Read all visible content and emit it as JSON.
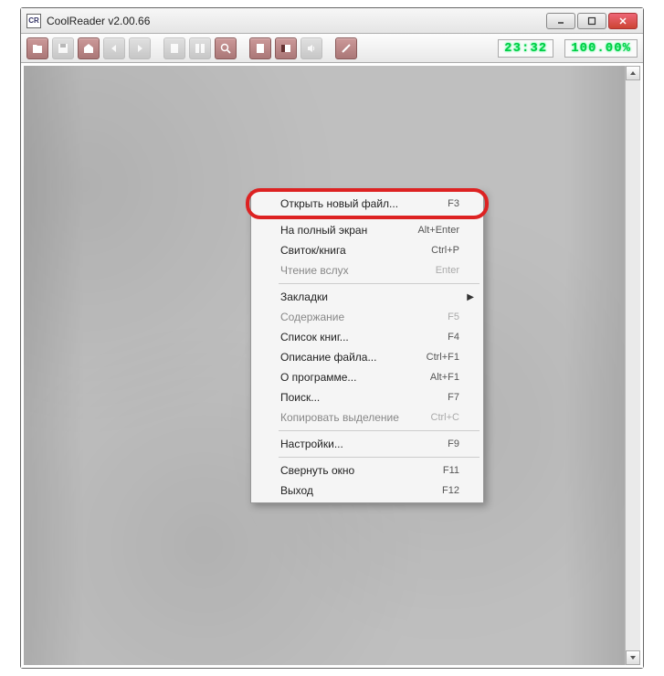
{
  "window": {
    "title": "CoolReader v2.00.66"
  },
  "status": {
    "time": "23:32",
    "percent": "100.00%"
  },
  "menu": {
    "items": [
      {
        "label": "Открыть новый файл...",
        "shortcut": "F3",
        "enabled": true
      },
      "sep",
      {
        "label": "На полный экран",
        "shortcut": "Alt+Enter",
        "enabled": true
      },
      {
        "label": "Свиток/книга",
        "shortcut": "Ctrl+P",
        "enabled": true
      },
      {
        "label": "Чтение вслух",
        "shortcut": "Enter",
        "enabled": false
      },
      "sep",
      {
        "label": "Закладки",
        "shortcut": "",
        "enabled": true,
        "submenu": true
      },
      {
        "label": "Содержание",
        "shortcut": "F5",
        "enabled": false
      },
      {
        "label": "Список книг...",
        "shortcut": "F4",
        "enabled": true
      },
      {
        "label": "Описание файла...",
        "shortcut": "Ctrl+F1",
        "enabled": true
      },
      {
        "label": "О программе...",
        "shortcut": "Alt+F1",
        "enabled": true
      },
      {
        "label": "Поиск...",
        "shortcut": "F7",
        "enabled": true
      },
      {
        "label": "Копировать выделение",
        "shortcut": "Ctrl+C",
        "enabled": false
      },
      "sep",
      {
        "label": "Настройки...",
        "shortcut": "F9",
        "enabled": true
      },
      "sep",
      {
        "label": "Свернуть окно",
        "shortcut": "F11",
        "enabled": true
      },
      {
        "label": "Выход",
        "shortcut": "F12",
        "enabled": true
      }
    ]
  },
  "toolbar_icons": [
    "open-icon",
    "save-icon",
    "home-icon",
    "back-icon",
    "forward-icon",
    "page-icon",
    "pages-icon",
    "search-icon",
    "book-icon",
    "view-icon",
    "sound-icon",
    "settings-icon"
  ]
}
